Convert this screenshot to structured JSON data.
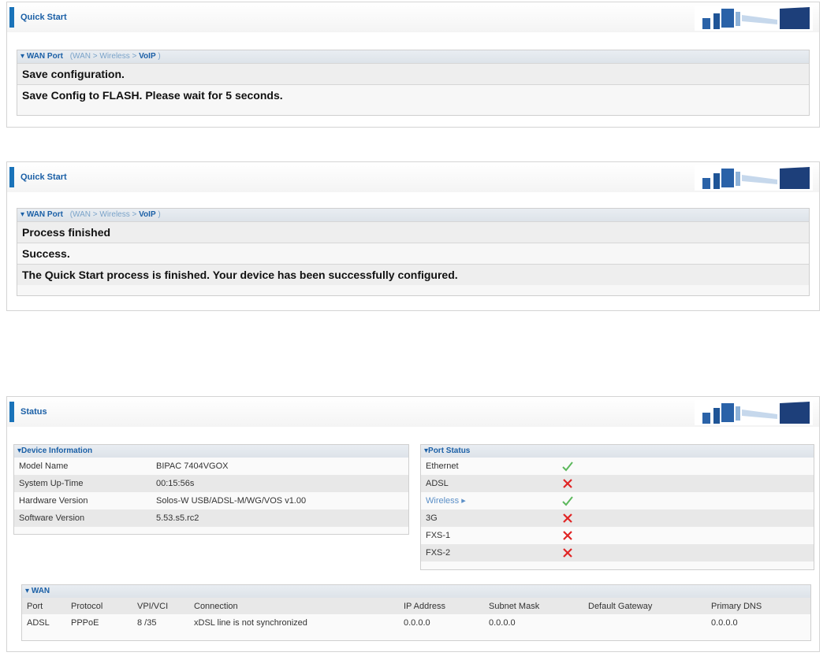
{
  "panel1": {
    "title": "Quick Start",
    "section_label": "WAN Port",
    "crumb_open": "(WAN > Wireless >",
    "crumb_current": "VoIP",
    "crumb_close": ")",
    "rows": [
      "Save configuration.",
      "Save Config to FLASH. Please wait for 5 seconds."
    ]
  },
  "panel2": {
    "title": "Quick Start",
    "section_label": "WAN Port",
    "crumb_open": "(WAN > Wireless >",
    "crumb_current": "VoIP",
    "crumb_close": ")",
    "rows": [
      "Process finished",
      "Success.",
      "The Quick Start process is finished. Your device has been successfully configured."
    ]
  },
  "status": {
    "title": "Status",
    "device_info": {
      "heading": "Device Information",
      "rows": [
        {
          "label": "Model Name",
          "value": "BIPAC 7404VGOX"
        },
        {
          "label": "System Up-Time",
          "value": "00:15:56s"
        },
        {
          "label": "Hardware Version",
          "value": "Solos-W USB/ADSL-M/WG/VOS v1.00"
        },
        {
          "label": "Software Version",
          "value": "5.53.s5.rc2"
        }
      ]
    },
    "port_status": {
      "heading": "Port Status",
      "rows": [
        {
          "label": "Ethernet",
          "status": "check-icon"
        },
        {
          "label": "ADSL",
          "status": "cross-icon"
        },
        {
          "label": "Wireless ▸",
          "status": "check-icon"
        },
        {
          "label": "3G",
          "status": "cross-icon"
        },
        {
          "label": "FXS-1",
          "status": "cross-icon"
        },
        {
          "label": "FXS-2",
          "status": "cross-icon"
        }
      ]
    },
    "wan": {
      "heading": "WAN",
      "columns": [
        "Port",
        "Protocol",
        "VPI/VCI",
        "Connection",
        "IP Address",
        "Subnet Mask",
        "Default Gateway",
        "Primary DNS"
      ],
      "row": [
        "ADSL",
        "PPPoE",
        "8 /35",
        "xDSL line is not synchronized",
        "0.0.0.0",
        "0.0.0.0",
        "",
        "0.0.0.0"
      ]
    }
  },
  "colors": {
    "accent": "#1a73b9",
    "check": "#5cb85c",
    "cross": "#e02424",
    "link": "#5b8fc7"
  }
}
